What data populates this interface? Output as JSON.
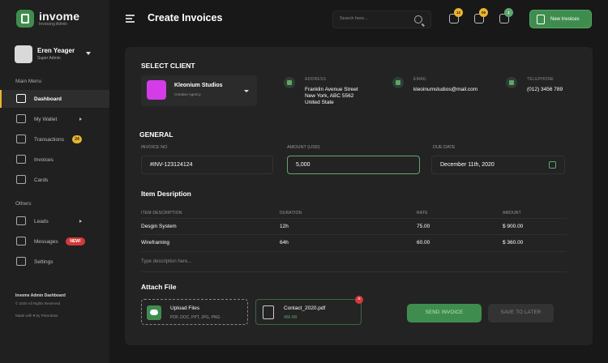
{
  "app": {
    "name": "invome",
    "subtitle": "Invoicing Admin"
  },
  "user": {
    "name": "Eren Yeager",
    "role": "Super Admin"
  },
  "sidebar": {
    "main_label": "Main Menu",
    "main_items": [
      {
        "label": "Dashboard",
        "icon": "grid-icon"
      },
      {
        "label": "My Wallet",
        "icon": "wallet-icon"
      },
      {
        "label": "Transactions",
        "icon": "chart-icon",
        "badge": "24"
      },
      {
        "label": "Invoices",
        "icon": "document-icon"
      },
      {
        "label": "Cards",
        "icon": "card-icon"
      }
    ],
    "others_label": "Others",
    "other_items": [
      {
        "label": "Leads",
        "icon": "user-icon"
      },
      {
        "label": "Messages",
        "icon": "chat-icon",
        "badge": "NEW!"
      },
      {
        "label": "Settings",
        "icon": "sliders-icon"
      }
    ],
    "footer_title": "Invome Admin Dashboard",
    "footer_copy": "© 2020 All Rights Reserved",
    "footer_made": "Made with ♥ by Peterdraw"
  },
  "header": {
    "title": "Create Invoices",
    "search_placeholder": "Search here...",
    "bell_count": "12",
    "chat_count": "05",
    "cart_count": "1",
    "new_button": "New Invoices"
  },
  "client": {
    "section_title": "SELECT CLIENT",
    "name": "Kleonium Studios",
    "type": "Creative Agency",
    "address_label": "ADDRESS",
    "address_lines": [
      "Franklin Avenue Street",
      "New York, ABC 5562",
      "United State"
    ],
    "email_label": "EMAIL",
    "email": "kleoinumstudios@mail.com",
    "phone_label": "TELEPHONE",
    "phone": "(012) 3456 789"
  },
  "general": {
    "section_title": "GENERAL",
    "invoice_no_label": "INVOICE NO",
    "invoice_no": "#INV-123124124",
    "amount_label": "AMOUNT (USD)",
    "amount": "5,000",
    "due_label": "DUE DATE",
    "due_date": "December 11th, 2020"
  },
  "items": {
    "section_title": "Item Desription",
    "headers": [
      "ITEM DESCRIPTION",
      "DURATION",
      "RATE",
      "AMOUNT"
    ],
    "rows": [
      {
        "desc": "Desgin System",
        "duration": "12h",
        "rate": "75.00",
        "amount": "$ 900.00"
      },
      {
        "desc": "Wireframing",
        "duration": "64h",
        "rate": "60.00",
        "amount": "$ 360.00"
      }
    ],
    "placeholder": "Type description here..."
  },
  "attach": {
    "section_title": "Attach File",
    "upload_title": "Upload Files",
    "upload_formats": "PDF, DOC, PPT, JPG, PNG",
    "file_name": "Contact_2020.pdf",
    "file_size": "456 KB"
  },
  "actions": {
    "send": "SEND INVOICE",
    "save": "SAVE TO LATER"
  },
  "colors": {
    "accent_green": "#3f8d4e",
    "badge_yellow": "#eab530",
    "badge_red": "#d23a3a",
    "client_logo": "#d33ce6"
  }
}
